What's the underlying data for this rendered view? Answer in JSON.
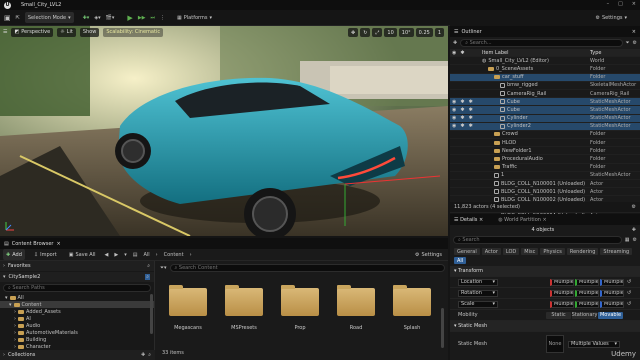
{
  "window": {
    "logo": "U",
    "tab": "Small_City_LVL2"
  },
  "toolbar": {
    "selection_mode": "Selection Mode",
    "platforms": "Platforms",
    "settings": "Settings"
  },
  "viewport": {
    "perspective": "Perspective",
    "lit": "Lit",
    "show": "Show",
    "scalability": "Scalability: Cinematic",
    "snap_value": "10",
    "snap_angle": "10°",
    "scale": "0.25",
    "camera_speed": "1"
  },
  "outliner": {
    "tab": "Outliner",
    "search_placeholder": "Search...",
    "col_label": "Item Label",
    "col_type": "Type",
    "rows": [
      {
        "label": "Small_City_LVL2 (Editor)",
        "type": "World",
        "indent": 0,
        "icon": "world",
        "sel": false,
        "vis": false
      },
      {
        "label": "0_SceneAssets",
        "type": "Folder",
        "indent": 1,
        "icon": "folder",
        "sel": false,
        "vis": false
      },
      {
        "label": "car_stuff",
        "type": "Folder",
        "indent": 2,
        "icon": "folder",
        "sel": true,
        "vis": false
      },
      {
        "label": "bmw_rigged",
        "type": "SkeletalMeshActor",
        "indent": 3,
        "icon": "actor",
        "sel": false,
        "vis": false
      },
      {
        "label": "CameraRig_Rail",
        "type": "CameraRig_Rail",
        "indent": 3,
        "icon": "actor",
        "sel": false,
        "vis": false
      },
      {
        "label": "Cube",
        "type": "StaticMeshActor",
        "indent": 3,
        "icon": "actor",
        "sel": true,
        "vis": true
      },
      {
        "label": "Cube",
        "type": "StaticMeshActor",
        "indent": 3,
        "icon": "actor",
        "sel": true,
        "vis": true
      },
      {
        "label": "Cylinder",
        "type": "StaticMeshActor",
        "indent": 3,
        "icon": "actor",
        "sel": true,
        "vis": true
      },
      {
        "label": "Cylinder2",
        "type": "StaticMeshActor",
        "indent": 3,
        "icon": "actor",
        "sel": true,
        "vis": true
      },
      {
        "label": "Crowd",
        "type": "Folder",
        "indent": 2,
        "icon": "folder",
        "sel": false,
        "vis": false
      },
      {
        "label": "HLOD",
        "type": "Folder",
        "indent": 2,
        "icon": "folder",
        "sel": false,
        "vis": false
      },
      {
        "label": "NewFolder1",
        "type": "Folder",
        "indent": 2,
        "icon": "folder",
        "sel": false,
        "vis": false
      },
      {
        "label": "ProceduralAudio",
        "type": "Folder",
        "indent": 2,
        "icon": "folder",
        "sel": false,
        "vis": false
      },
      {
        "label": "Traffic",
        "type": "Folder",
        "indent": 2,
        "icon": "folder",
        "sel": false,
        "vis": false
      },
      {
        "label": "1",
        "type": "StaticMeshActor",
        "indent": 2,
        "icon": "actor",
        "sel": false,
        "vis": false
      },
      {
        "label": "BLDG_COLL_N100001 (Unloaded)",
        "type": "Actor",
        "indent": 2,
        "icon": "actor",
        "sel": false,
        "vis": false
      },
      {
        "label": "BLDG_COLL_N100001 (Unloaded)",
        "type": "Actor",
        "indent": 2,
        "icon": "actor",
        "sel": false,
        "vis": false
      },
      {
        "label": "BLDG_COLL_N100002 (Unloaded)",
        "type": "Actor",
        "indent": 2,
        "icon": "actor",
        "sel": false,
        "vis": false
      },
      {
        "label": "BLDG_COLL_N100003 (Unloaded)",
        "type": "Actor",
        "indent": 2,
        "icon": "actor",
        "sel": false,
        "vis": false
      },
      {
        "label": "BLDG_COLL_N100004 (Unloaded)",
        "type": "Actor",
        "indent": 2,
        "icon": "actor",
        "sel": false,
        "vis": false
      }
    ],
    "footer": "11,823 actors (4 selected)"
  },
  "details": {
    "tab": "Details",
    "tab2": "World Partition",
    "objects": "4 objects",
    "search_placeholder": "Search",
    "categories": [
      "General",
      "Actor",
      "LOD",
      "Misc",
      "Physics",
      "Rendering",
      "Streaming",
      "All"
    ],
    "transform_header": "Transform",
    "props": [
      {
        "label": "Location",
        "values": [
          "Multiple Va",
          "Multiple Va",
          "Multiple Va"
        ]
      },
      {
        "label": "Rotation",
        "values": [
          "Multiple Va",
          "Multiple Va",
          "Multiple Va"
        ]
      },
      {
        "label": "Scale",
        "values": [
          "Multiple Va",
          "Multiple Va",
          "Multiple Va"
        ]
      }
    ],
    "mobility_label": "Mobility",
    "mobility": [
      "Static",
      "Stationary",
      "Movable"
    ],
    "static_mesh_header": "Static Mesh",
    "static_mesh_label": "Static Mesh",
    "static_mesh_value": "Multiple Values",
    "static_mesh_thumb": "None"
  },
  "content_browser": {
    "tab": "Content Browser",
    "add": "Add",
    "import": "Import",
    "save_all": "Save All",
    "path": [
      "All",
      "Content"
    ],
    "settings": "Settings",
    "favorites": "Favorites",
    "project": "CitySample2",
    "search_paths": "Search Paths",
    "tree": [
      "All",
      "Content",
      "Added_Assets",
      "AI",
      "Audio",
      "AutomotiveMaterials",
      "Building",
      "Character"
    ],
    "collections": "Collections",
    "search_placeholder": "Search Content",
    "folders": [
      "Megascans",
      "MSPresets",
      "Prop",
      "Road",
      "Splash"
    ],
    "item_count": "33 items"
  },
  "watermark": "Udemy"
}
